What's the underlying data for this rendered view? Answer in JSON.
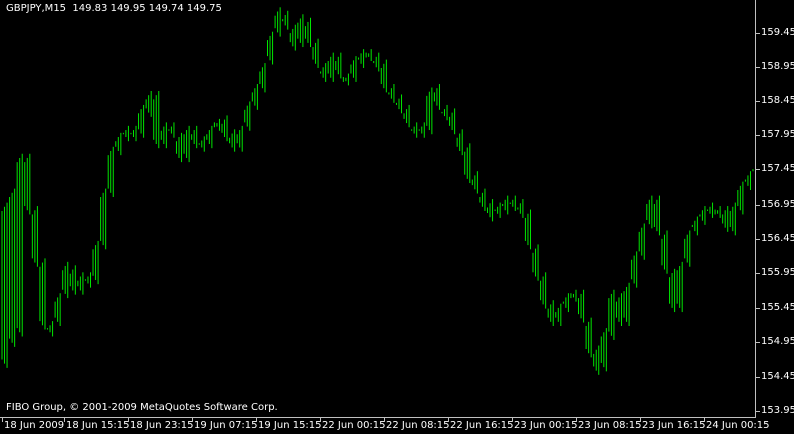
{
  "header": {
    "symbol_timeframe": "GBPJPY,M15",
    "ohlc": "149.83 149.95 149.74 149.75"
  },
  "copyright": "FIBO Group, © 2001-2009 MetaQuotes Software Corp.",
  "colors": {
    "background": "#000000",
    "bars": "#00ff00",
    "axis": "#c0c0c0",
    "text": "#ffffff"
  },
  "y_axis": {
    "ticks": [
      "159.45",
      "158.95",
      "158.45",
      "157.95",
      "157.45",
      "156.95",
      "156.45",
      "155.95",
      "155.45",
      "154.95",
      "154.45",
      "153.95"
    ]
  },
  "x_axis": {
    "ticks": [
      "18 Jun 2009",
      "18 Jun 15:15",
      "18 Jun 23:15",
      "19 Jun 07:15",
      "19 Jun 15:15",
      "22 Jun 00:15",
      "22 Jun 08:15",
      "22 Jun 16:15",
      "23 Jun 00:15",
      "23 Jun 08:15",
      "23 Jun 16:15",
      "24 Jun 00:15"
    ]
  },
  "chart_data": {
    "type": "line",
    "series": [],
    "ylim": [
      153.85,
      159.6
    ],
    "grid": false,
    "path_points": [
      [
        154.5,
        156.75
      ],
      [
        154.8,
        156.95
      ],
      [
        154.95,
        157.45
      ],
      [
        157.45,
        156.7
      ],
      [
        156.7,
        155.95
      ],
      [
        155.95,
        155.05
      ],
      [
        155.05,
        154.95
      ],
      [
        155.1,
        155.45
      ],
      [
        155.5,
        155.9
      ],
      [
        155.85,
        155.55
      ],
      [
        155.55,
        155.75
      ],
      [
        155.75,
        155.65
      ],
      [
        155.7,
        156.2
      ],
      [
        156.2,
        156.95
      ],
      [
        156.95,
        157.55
      ],
      [
        157.55,
        157.75
      ],
      [
        157.75,
        157.85
      ],
      [
        157.85,
        157.75
      ],
      [
        157.8,
        158.15
      ],
      [
        158.1,
        158.35
      ],
      [
        158.35,
        157.65
      ],
      [
        157.65,
        157.9
      ],
      [
        157.9,
        157.8
      ],
      [
        157.75,
        157.45
      ],
      [
        157.45,
        157.85
      ],
      [
        157.85,
        157.65
      ],
      [
        157.6,
        157.7
      ],
      [
        157.65,
        157.85
      ],
      [
        157.9,
        157.95
      ],
      [
        158.0,
        157.75
      ],
      [
        157.8,
        157.6
      ],
      [
        157.6,
        157.85
      ],
      [
        157.9,
        158.2
      ],
      [
        158.2,
        158.45
      ],
      [
        158.45,
        158.75
      ],
      [
        158.85,
        159.2
      ],
      [
        159.25,
        159.55
      ],
      [
        159.5,
        159.35
      ],
      [
        159.3,
        159.05
      ],
      [
        159.1,
        159.45
      ],
      [
        159.4,
        159.1
      ],
      [
        159.1,
        158.8
      ],
      [
        158.75,
        158.6
      ],
      [
        158.6,
        158.9
      ],
      [
        158.9,
        158.65
      ],
      [
        158.6,
        158.55
      ],
      [
        158.6,
        158.85
      ],
      [
        158.8,
        158.95
      ],
      [
        158.95,
        158.9
      ],
      [
        158.9,
        158.75
      ],
      [
        158.8,
        158.45
      ],
      [
        158.45,
        158.3
      ],
      [
        158.3,
        158.15
      ],
      [
        158.15,
        157.95
      ],
      [
        157.9,
        157.8
      ],
      [
        157.8,
        157.9
      ],
      [
        157.85,
        158.4
      ],
      [
        158.45,
        158.2
      ],
      [
        158.15,
        158.05
      ],
      [
        158.1,
        157.85
      ],
      [
        157.8,
        157.55
      ],
      [
        157.6,
        157.15
      ],
      [
        157.2,
        157.0
      ],
      [
        156.95,
        156.75
      ],
      [
        156.8,
        156.6
      ],
      [
        156.65,
        156.75
      ],
      [
        156.7,
        156.85
      ],
      [
        156.85,
        156.75
      ],
      [
        156.8,
        156.65
      ],
      [
        156.65,
        156.2
      ],
      [
        156.15,
        155.75
      ],
      [
        155.75,
        155.35
      ],
      [
        155.35,
        155.1
      ],
      [
        155.1,
        155.3
      ],
      [
        155.3,
        155.45
      ],
      [
        155.45,
        155.5
      ],
      [
        155.5,
        155.15
      ],
      [
        155.1,
        154.65
      ],
      [
        154.7,
        154.4
      ],
      [
        154.45,
        154.95
      ],
      [
        154.9,
        155.5
      ],
      [
        155.45,
        155.1
      ],
      [
        155.1,
        155.6
      ],
      [
        155.65,
        156.05
      ],
      [
        156.05,
        156.45
      ],
      [
        156.5,
        156.85
      ],
      [
        156.85,
        156.4
      ],
      [
        156.35,
        155.85
      ],
      [
        155.8,
        155.3
      ],
      [
        155.3,
        155.9
      ],
      [
        155.95,
        156.35
      ],
      [
        156.4,
        156.55
      ],
      [
        156.55,
        156.7
      ],
      [
        156.75,
        156.65
      ],
      [
        156.65,
        156.7
      ],
      [
        156.7,
        156.45
      ],
      [
        156.4,
        156.75
      ],
      [
        156.7,
        157.05
      ],
      [
        157.05,
        157.2
      ],
      [
        157.2,
        157.35
      ]
    ]
  }
}
